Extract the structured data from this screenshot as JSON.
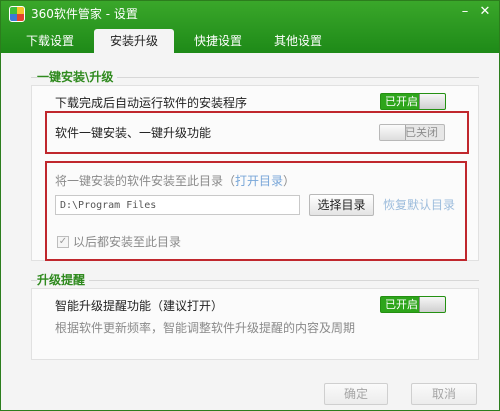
{
  "window": {
    "title": "360软件管家 - 设置",
    "minimize_glyph": "–",
    "close_glyph": "✕"
  },
  "tabs": [
    {
      "label": "下载设置"
    },
    {
      "label": "安装升级",
      "active": true
    },
    {
      "label": "快捷设置"
    },
    {
      "label": "其他设置"
    }
  ],
  "install_section": {
    "title": "一键安装\\升级",
    "auto_run": {
      "label": "下载完成后自动运行软件的安装程序",
      "toggle": "已开启",
      "enabled": true
    },
    "one_click": {
      "label": "软件一键安装、一键升级功能",
      "toggle": "已关闭",
      "enabled": false
    },
    "dir_hint_prefix": "将一键安装的软件安装至此目录（",
    "dir_hint_link": "打开目录",
    "dir_hint_suffix": "）",
    "dir_path": "D:\\Program Files",
    "choose_dir": "选择目录",
    "restore_default": "恢复默认目录",
    "always_install_here": {
      "label": "以后都安装至此目录",
      "checked": true,
      "check_glyph": "✓"
    }
  },
  "upgrade_section": {
    "title": "升级提醒",
    "smart_reminder": {
      "label": "智能升级提醒功能（建议打开）",
      "toggle": "已开启",
      "enabled": true
    },
    "description": "根据软件更新频率，智能调整软件升级提醒的内容及周期"
  },
  "footer": {
    "ok": "确定",
    "cancel": "取消"
  },
  "colors": {
    "brand_green": "#2ea51b",
    "highlight_red": "#c0272d",
    "section_title": "#2f8a1e"
  }
}
